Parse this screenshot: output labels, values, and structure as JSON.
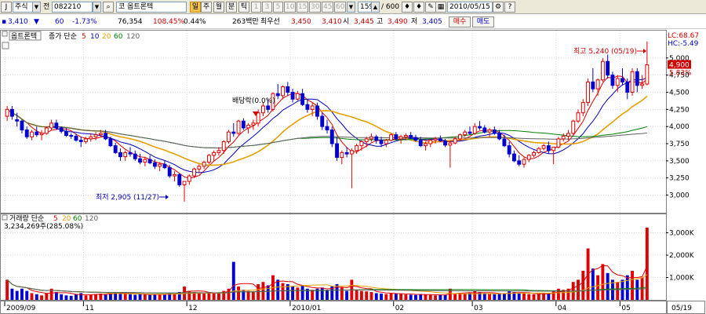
{
  "toolbar": {
    "market_select": "주식",
    "jeon_label": "전",
    "code": "082210",
    "stock_name": "옵트론텍",
    "price_toggle": "일",
    "period_buttons": [
      "주",
      "월",
      "분",
      "틱"
    ],
    "interval_buttons": [
      "1",
      "3",
      "5",
      "10",
      "15",
      "30",
      "45",
      "60"
    ],
    "count": "159",
    "count_total": "/ 600",
    "date": "2010/05/15",
    "buy_button": "매수",
    "sell_button": "매도"
  },
  "quote": {
    "price": "3,410",
    "change": "60",
    "change_pct": "-1.73%",
    "volume": "76,354",
    "turnover_pct": "108.45%",
    "ratio": "0.44%",
    "amount": "263백만",
    "pref_label": "최우선",
    "ask": "3,450",
    "bid": "3,410",
    "open_label": "시",
    "open": "3,445",
    "high_label": "고",
    "high": "3,490",
    "low_label": "저",
    "low": "3,405"
  },
  "price_panel": {
    "name_tag": "옵트론텍",
    "legend_label": "종가 단순",
    "ma_periods": [
      "5",
      "10",
      "20",
      "60",
      "120"
    ],
    "ma_colors": [
      "#e00000",
      "#0000c0",
      "#e8a000",
      "#008000",
      "#606060"
    ],
    "right_labels": {
      "lc": "LC:68.67",
      "hc": "HC:-5.49"
    },
    "current_price_tag": "4,900",
    "current_pct_tag": "5.83%",
    "y_ticks": [
      "5,000",
      "4,750",
      "4,500",
      "4,250",
      "4,000",
      "3,750",
      "3,500",
      "3,250",
      "3,000"
    ],
    "annotations": {
      "high": "최고 5,240 (05/19)",
      "low": "최저 2,905 (11/27)",
      "dividend": "배당락(0.0%)"
    }
  },
  "volume_panel": {
    "legend_label": "거래량 단순",
    "ma_periods": [
      "5",
      "20",
      "60",
      "120"
    ],
    "ma_colors": [
      "#e00000",
      "#e8a000",
      "#008000",
      "#606060"
    ],
    "value_label": "3,234,269주(285.08%)",
    "y_ticks": [
      "3,000K",
      "2,000K",
      "1,000K"
    ]
  },
  "x_axis": {
    "labels": [
      "2009/09",
      "11",
      "12",
      "2010/01",
      "02",
      "03",
      "04",
      "05"
    ],
    "right_label": "05/19"
  },
  "chart_data": {
    "type": "candlestick",
    "price_axis": {
      "min": 2800,
      "max": 5250
    },
    "volume_axis": {
      "min": 0,
      "max": 3300000
    },
    "candles": [
      [
        4150,
        4300,
        4080,
        4250,
        900000
      ],
      [
        4250,
        4300,
        4100,
        4150,
        500000
      ],
      [
        4100,
        4200,
        4000,
        4080,
        400000
      ],
      [
        4080,
        4100,
        3900,
        3950,
        500000
      ],
      [
        3950,
        4000,
        3820,
        3850,
        400000
      ],
      [
        3850,
        3950,
        3800,
        3920,
        300000
      ],
      [
        3920,
        4000,
        3850,
        3880,
        250000
      ],
      [
        3880,
        3950,
        3800,
        3900,
        200000
      ],
      [
        3900,
        4000,
        3880,
        3980,
        300000
      ],
      [
        3980,
        4100,
        3950,
        4050,
        500000
      ],
      [
        4050,
        4100,
        3950,
        3980,
        350000
      ],
      [
        3980,
        4000,
        3900,
        3930,
        250000
      ],
      [
        3930,
        3980,
        3850,
        3870,
        200000
      ],
      [
        3870,
        3900,
        3820,
        3860,
        180000
      ],
      [
        3860,
        3900,
        3780,
        3800,
        250000
      ],
      [
        3800,
        3850,
        3700,
        3780,
        300000
      ],
      [
        3780,
        3850,
        3750,
        3820,
        200000
      ],
      [
        3820,
        3900,
        3780,
        3850,
        220000
      ],
      [
        3850,
        3920,
        3800,
        3880,
        250000
      ],
      [
        3880,
        3950,
        3850,
        3900,
        280000
      ],
      [
        3900,
        3950,
        3800,
        3820,
        260000
      ],
      [
        3820,
        3850,
        3700,
        3720,
        300000
      ],
      [
        3720,
        3760,
        3600,
        3620,
        350000
      ],
      [
        3620,
        3680,
        3500,
        3560,
        300000
      ],
      [
        3560,
        3650,
        3500,
        3620,
        280000
      ],
      [
        3620,
        3700,
        3560,
        3600,
        250000
      ],
      [
        3600,
        3650,
        3500,
        3530,
        230000
      ],
      [
        3530,
        3600,
        3450,
        3480,
        260000
      ],
      [
        3480,
        3560,
        3420,
        3520,
        240000
      ],
      [
        3520,
        3580,
        3450,
        3470,
        220000
      ],
      [
        3470,
        3520,
        3380,
        3420,
        260000
      ],
      [
        3420,
        3480,
        3350,
        3450,
        240000
      ],
      [
        3450,
        3500,
        3380,
        3400,
        230000
      ],
      [
        3400,
        3440,
        3250,
        3280,
        300000
      ],
      [
        3280,
        3350,
        3200,
        3300,
        280000
      ],
      [
        3300,
        3320,
        3120,
        3150,
        350000
      ],
      [
        3150,
        3200,
        2905,
        3200,
        600000
      ],
      [
        3200,
        3300,
        3150,
        3280,
        400000
      ],
      [
        3280,
        3400,
        3250,
        3380,
        350000
      ],
      [
        3380,
        3450,
        3320,
        3420,
        300000
      ],
      [
        3420,
        3500,
        3380,
        3480,
        280000
      ],
      [
        3480,
        3600,
        3450,
        3580,
        350000
      ],
      [
        3580,
        3650,
        3500,
        3620,
        300000
      ],
      [
        3620,
        3700,
        3580,
        3650,
        320000
      ],
      [
        3650,
        3800,
        3600,
        3780,
        400000
      ],
      [
        3780,
        3950,
        3750,
        3920,
        500000
      ],
      [
        3920,
        4050,
        3850,
        3900,
        1700000
      ],
      [
        3900,
        4100,
        3880,
        4080,
        600000
      ],
      [
        4080,
        4120,
        3950,
        3980,
        450000
      ],
      [
        3980,
        4050,
        3900,
        4020,
        400000
      ],
      [
        4020,
        4100,
        3950,
        4050,
        380000
      ],
      [
        4050,
        4250,
        4000,
        4200,
        700000
      ],
      [
        4200,
        4350,
        4150,
        4300,
        800000
      ],
      [
        4300,
        4400,
        4200,
        4250,
        650000
      ],
      [
        4250,
        4500,
        4220,
        4480,
        1100000
      ],
      [
        4480,
        4620,
        4400,
        4450,
        900000
      ],
      [
        4450,
        4600,
        4400,
        4580,
        750000
      ],
      [
        4580,
        4650,
        4450,
        4500,
        700000
      ],
      [
        4500,
        4550,
        4350,
        4400,
        600000
      ],
      [
        4400,
        4520,
        4380,
        4480,
        550000
      ],
      [
        4480,
        4550,
        4300,
        4320,
        650000
      ],
      [
        4320,
        4400,
        4200,
        4250,
        500000
      ],
      [
        4250,
        4350,
        4150,
        4300,
        450000
      ],
      [
        4300,
        4350,
        4100,
        4150,
        500000
      ],
      [
        4150,
        4200,
        3950,
        4000,
        550000
      ],
      [
        4000,
        4100,
        3900,
        3950,
        450000
      ],
      [
        3950,
        4000,
        3700,
        3750,
        600000
      ],
      [
        3750,
        3850,
        3500,
        3550,
        700000
      ],
      [
        3550,
        3650,
        3450,
        3620,
        550000
      ],
      [
        3620,
        3700,
        3550,
        3600,
        400000
      ],
      [
        3600,
        3680,
        3100,
        3650,
        900000
      ],
      [
        3650,
        3750,
        3600,
        3720,
        450000
      ],
      [
        3720,
        3800,
        3650,
        3780,
        400000
      ],
      [
        3780,
        3850,
        3700,
        3820,
        380000
      ],
      [
        3820,
        3900,
        3780,
        3850,
        350000
      ],
      [
        3850,
        3880,
        3750,
        3800,
        300000
      ],
      [
        3800,
        3850,
        3700,
        3750,
        280000
      ],
      [
        3750,
        3820,
        3700,
        3800,
        260000
      ],
      [
        3800,
        3900,
        3780,
        3880,
        300000
      ],
      [
        3880,
        3920,
        3800,
        3820,
        280000
      ],
      [
        3820,
        3880,
        3750,
        3850,
        260000
      ],
      [
        3850,
        3900,
        3800,
        3870,
        240000
      ],
      [
        3870,
        3920,
        3820,
        3840,
        230000
      ],
      [
        3840,
        3880,
        3780,
        3800,
        220000
      ],
      [
        3800,
        3850,
        3700,
        3720,
        260000
      ],
      [
        3720,
        3780,
        3650,
        3750,
        240000
      ],
      [
        3750,
        3820,
        3700,
        3800,
        220000
      ],
      [
        3800,
        3850,
        3750,
        3820,
        200000
      ],
      [
        3820,
        3870,
        3780,
        3790,
        210000
      ],
      [
        3790,
        3820,
        3700,
        3730,
        230000
      ],
      [
        3730,
        3780,
        3400,
        3760,
        500000
      ],
      [
        3760,
        3850,
        3740,
        3820,
        260000
      ],
      [
        3820,
        3900,
        3800,
        3880,
        300000
      ],
      [
        3880,
        3950,
        3850,
        3920,
        280000
      ],
      [
        3920,
        4000,
        3880,
        3900,
        300000
      ],
      [
        3900,
        4050,
        3880,
        4000,
        400000
      ],
      [
        4000,
        4080,
        3950,
        3980,
        350000
      ],
      [
        3980,
        4020,
        3900,
        3920,
        300000
      ],
      [
        3920,
        3980,
        3850,
        3950,
        260000
      ],
      [
        3950,
        4000,
        3880,
        3900,
        250000
      ],
      [
        3900,
        3950,
        3800,
        3820,
        280000
      ],
      [
        3820,
        3880,
        3700,
        3720,
        300000
      ],
      [
        3720,
        3780,
        3550,
        3600,
        400000
      ],
      [
        3600,
        3650,
        3480,
        3500,
        350000
      ],
      [
        3500,
        3580,
        3420,
        3450,
        300000
      ],
      [
        3450,
        3550,
        3400,
        3520,
        280000
      ],
      [
        3520,
        3600,
        3480,
        3580,
        260000
      ],
      [
        3580,
        3650,
        3550,
        3620,
        250000
      ],
      [
        3620,
        3700,
        3600,
        3680,
        280000
      ],
      [
        3680,
        3750,
        3650,
        3720,
        300000
      ],
      [
        3720,
        3780,
        3600,
        3650,
        280000
      ],
      [
        3650,
        3700,
        3450,
        3700,
        400000
      ],
      [
        3700,
        3850,
        3680,
        3820,
        500000
      ],
      [
        3820,
        3900,
        3780,
        3860,
        450000
      ],
      [
        3860,
        3950,
        3800,
        3900,
        500000
      ],
      [
        3900,
        4100,
        3880,
        4080,
        800000
      ],
      [
        4080,
        4250,
        4050,
        4200,
        900000
      ],
      [
        4200,
        4400,
        4150,
        4350,
        1300000
      ],
      [
        4350,
        4700,
        4300,
        4650,
        2300000
      ],
      [
        4650,
        4850,
        4500,
        4550,
        1400000
      ],
      [
        4550,
        4700,
        4450,
        4680,
        1100000
      ],
      [
        4680,
        5000,
        4650,
        4950,
        1600000
      ],
      [
        4950,
        5050,
        4700,
        4750,
        1200000
      ],
      [
        4750,
        4800,
        4550,
        4600,
        900000
      ],
      [
        4600,
        4750,
        4500,
        4700,
        800000
      ],
      [
        4700,
        4850,
        4600,
        4650,
        900000
      ],
      [
        4650,
        4700,
        4400,
        4500,
        1100000
      ],
      [
        4500,
        4850,
        4450,
        4800,
        1300000
      ],
      [
        4800,
        4850,
        4500,
        4600,
        900000
      ],
      [
        4600,
        4750,
        4550,
        4620,
        1000000
      ],
      [
        4620,
        5240,
        4600,
        4900,
        3234269
      ]
    ]
  }
}
